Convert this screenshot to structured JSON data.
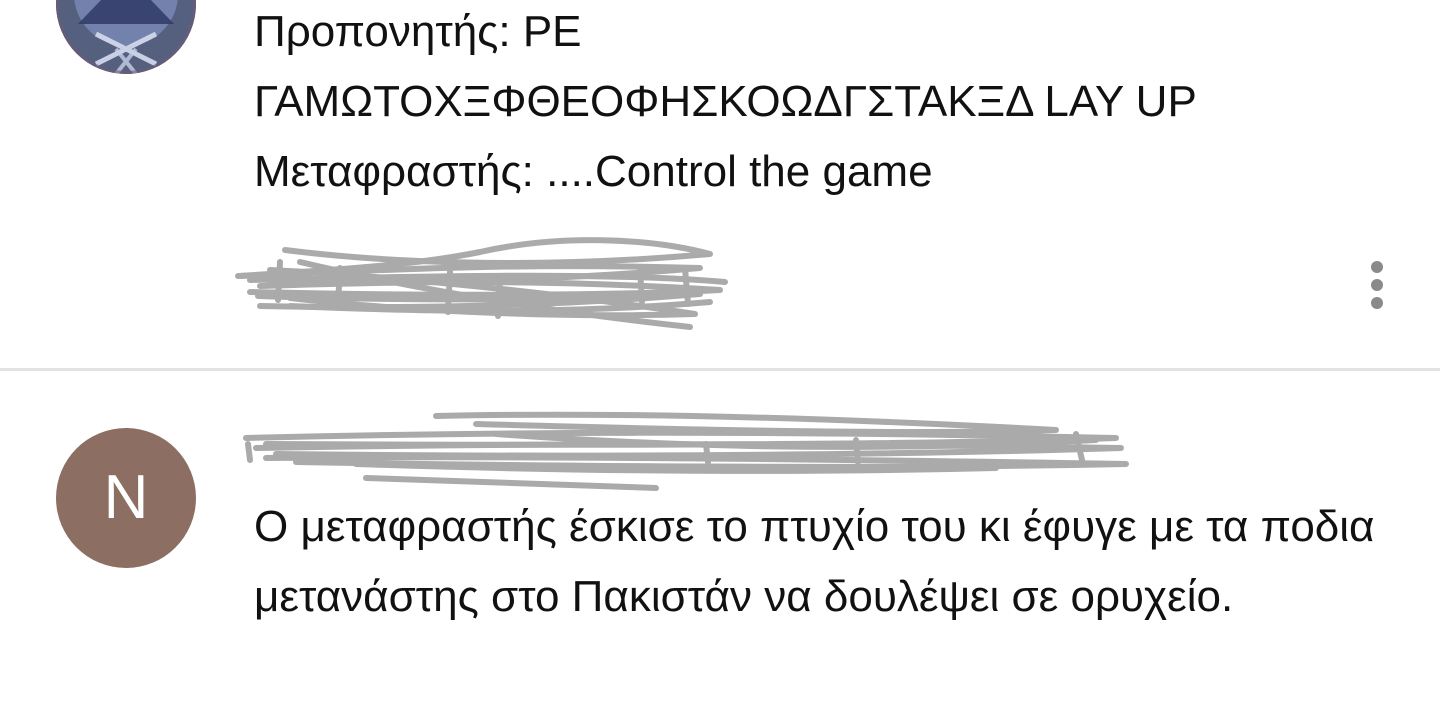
{
  "comments": [
    {
      "avatar": {
        "kind": "image",
        "icon": "user-avatar-image"
      },
      "lines": [
        "Προπονητής: ΡΕ",
        "ΓΑΜΩΤΟΧΞΦΘΕΟΦΗΣΚΟΩΔΓΣΤΑΚΞΔ LAY UP",
        "Μεταφραστής: ....Control the game"
      ],
      "author_redacted": true,
      "more_icon": "more-vertical-icon"
    },
    {
      "avatar": {
        "kind": "letter",
        "letter": "N",
        "color": "#8d6e63"
      },
      "author_redacted": true,
      "body": "Ο μεταφραστής έσκισε το πτυχίο του κι έφυγε με τα ποδια μετανάστης στο Πακιστάν να δουλέψει σε ορυχείο."
    }
  ],
  "colors": {
    "scribble": "#a6a6a6",
    "divider": "#e2e2e2",
    "text": "#111111",
    "more_icon": "#8a8a8a"
  }
}
